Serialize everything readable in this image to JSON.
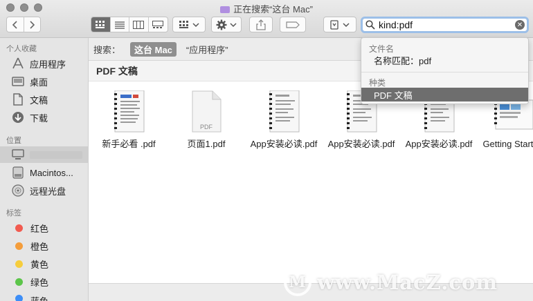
{
  "window": {
    "title": "正在搜索“这台 Mac”"
  },
  "search": {
    "query": "kind:pdf"
  },
  "dropdown": {
    "filename_header": "文件名",
    "filename_item": "名称匹配：pdf",
    "kind_header": "种类",
    "kind_item": "PDF 文稿"
  },
  "sidebar": {
    "favorites_header": "个人收藏",
    "favorites": [
      {
        "label": "应用程序",
        "icon": "applications-icon"
      },
      {
        "label": "桌面",
        "icon": "desktop-icon"
      },
      {
        "label": "文稿",
        "icon": "documents-icon"
      },
      {
        "label": "下载",
        "icon": "downloads-icon"
      }
    ],
    "locations_header": "位置",
    "locations": [
      {
        "label": "Macintos...",
        "icon": "disk-icon"
      },
      {
        "label": "远程光盘",
        "icon": "optical-disc-icon"
      }
    ],
    "tags_header": "标签",
    "tags": [
      {
        "label": "红色",
        "color": "#f25b50"
      },
      {
        "label": "橙色",
        "color": "#f49d3b"
      },
      {
        "label": "黄色",
        "color": "#f6cd3c"
      },
      {
        "label": "绿色",
        "color": "#5cc54a"
      },
      {
        "label": "蓝色",
        "color": "#3d8ef7"
      }
    ]
  },
  "scopebar": {
    "label": "搜索：",
    "scope_this_mac": "这台 Mac",
    "scope_apps": "“应用程序”"
  },
  "group": {
    "title": "PDF 文稿"
  },
  "files": [
    {
      "name": "新手必看 .pdf",
      "kind": "notebook"
    },
    {
      "name": "页面1.pdf",
      "kind": "blank",
      "badge": "PDF"
    },
    {
      "name": "App安装必读.pdf",
      "kind": "notebook"
    },
    {
      "name": "App安装必读.pdf",
      "kind": "notebook"
    },
    {
      "name": "App安装必读.pdf",
      "kind": "notebook"
    },
    {
      "name": "Getting Started.pdf",
      "kind": "colorful"
    }
  ],
  "watermark": {
    "logo_letter": "M",
    "text": "www.MacZ.com"
  }
}
